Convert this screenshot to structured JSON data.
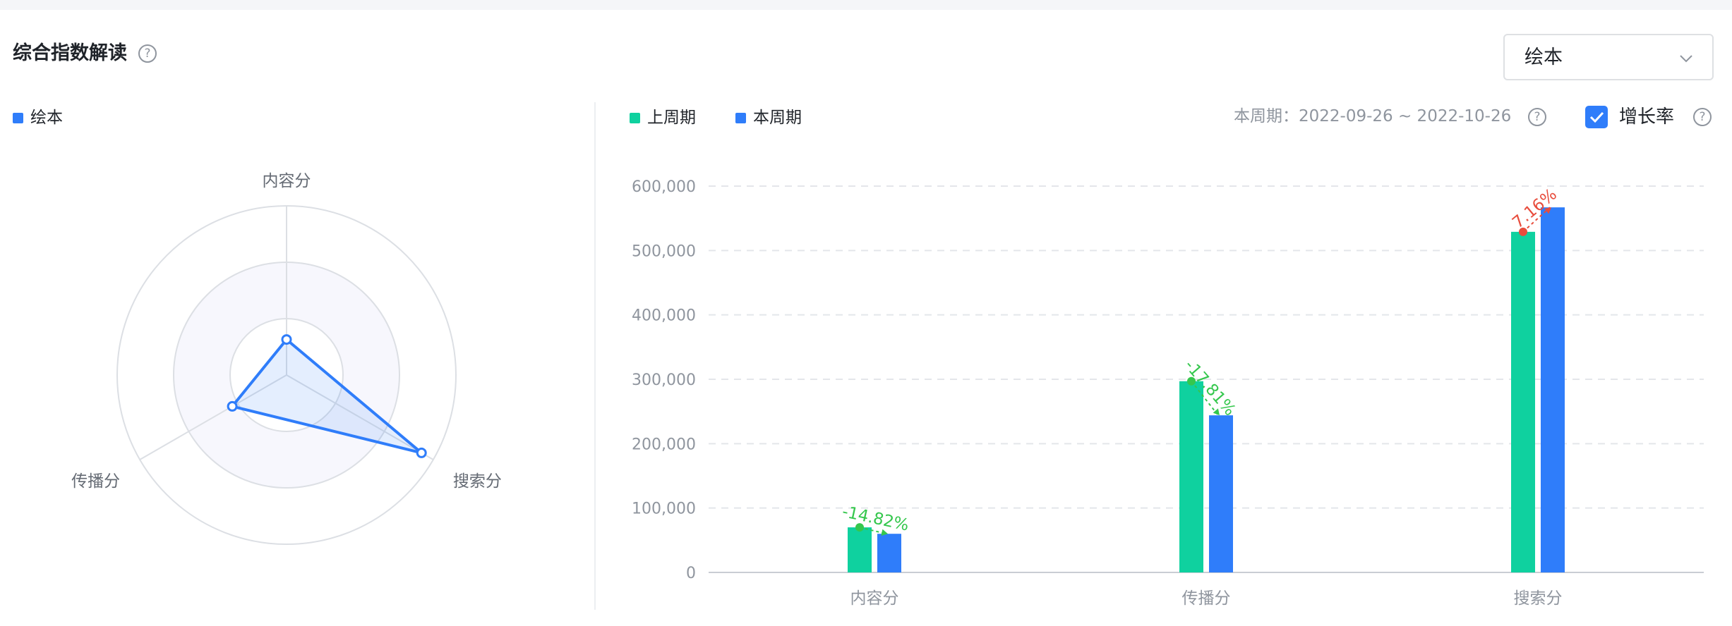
{
  "header": {
    "title": "综合指数解读",
    "help_icon": "question-circle-icon",
    "select": {
      "value": "绘本",
      "icon": "chevron-down-icon"
    }
  },
  "radar": {
    "legend": {
      "label": "绘本",
      "color": "#2f7dfa"
    },
    "indicators": [
      "内容分",
      "传播分",
      "搜索分"
    ],
    "series_relative_values": [
      0.21,
      0.37,
      0.92
    ]
  },
  "bar": {
    "legend": [
      {
        "label": "上周期",
        "color": "#0fd19f"
      },
      {
        "label": "本周期",
        "color": "#2f7dfa"
      }
    ],
    "period": {
      "text": "本周期：2022-09-26 ~ 2022-10-26",
      "help_icon": "question-circle-icon"
    },
    "growth_toggle": {
      "label": "增长率",
      "checked": true,
      "help_icon": "question-circle-icon",
      "check_icon": "check-icon"
    },
    "colors": {
      "up": "#e84d3d",
      "down": "#35c74d",
      "grid": "#e4e6ea",
      "axis_text": "#8f959e"
    }
  },
  "chart_data": [
    {
      "type": "radar",
      "indicators": [
        "内容分",
        "传播分",
        "搜索分"
      ],
      "series": [
        {
          "name": "绘本",
          "values": [
            0.21,
            0.37,
            0.92
          ]
        }
      ],
      "legend": "top-left"
    },
    {
      "type": "bar",
      "categories": [
        "内容分",
        "传播分",
        "搜索分"
      ],
      "series": [
        {
          "name": "上周期",
          "values": [
            70000,
            297000,
            529000
          ]
        },
        {
          "name": "本周期",
          "values": [
            60000,
            244000,
            567000
          ]
        }
      ],
      "growth_rates": [
        "-14.82%",
        "-17.81%",
        "7.16%"
      ],
      "ylim": [
        0,
        600000
      ],
      "yticks": [
        "0",
        "100,000",
        "200,000",
        "300,000",
        "400,000",
        "500,000",
        "600,000"
      ],
      "grid": true,
      "legend": "top-left"
    }
  ]
}
